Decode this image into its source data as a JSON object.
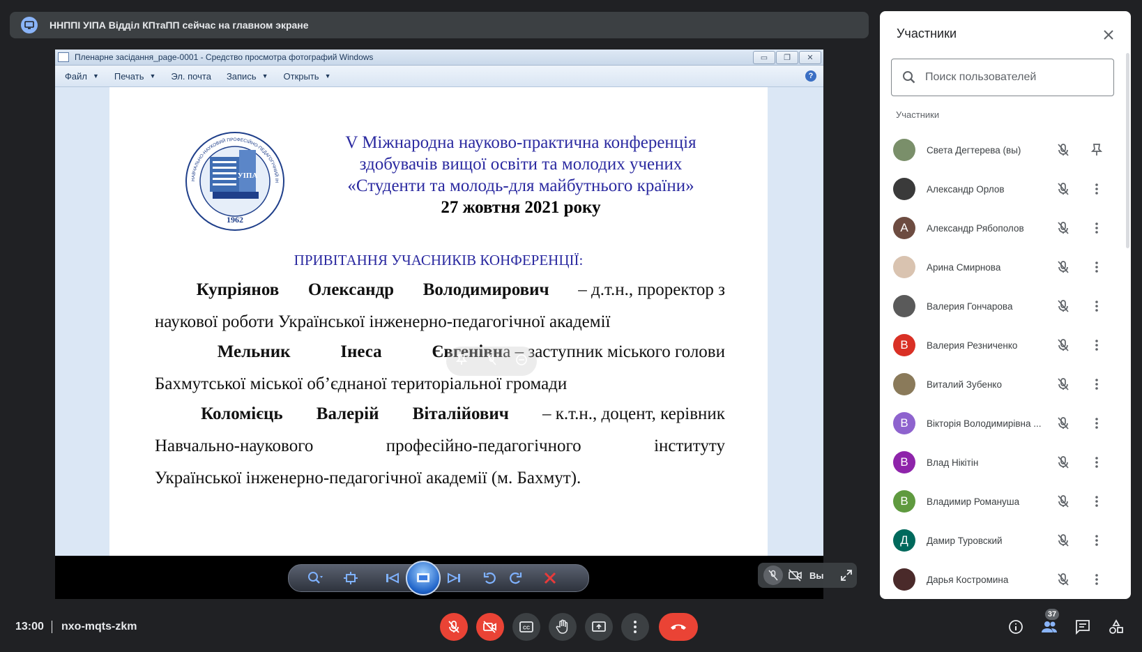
{
  "banner": {
    "text": "ННППІ УІПА Відділ КПтаПП сейчас на главном экране"
  },
  "viewer": {
    "title": "Пленарне засідання_page-0001 - Средство просмотра фотографий Windows",
    "menu": [
      "Файл",
      "Печать",
      "Эл. почта",
      "Запись",
      "Открыть"
    ],
    "help": "?"
  },
  "document": {
    "logo_year": "1962",
    "logo_text": "УІПА",
    "logo_ring": "НАВЧАЛЬНО-НАУКОВИЙ ПРОФЕСІЙНО-ПЕДАГОГІЧНИЙ ІНСТИТУТ",
    "conf_line1": "V Міжнародна науково-практична конференція",
    "conf_line2": "здобувачів вищої освіти та молодих учених",
    "conf_line3": "«Студенти та молодь-для майбутнього країни»",
    "conf_date": "27 жовтня 2021 року",
    "greeting": "ПРИВІТАННЯ УЧАСНИКІВ КОНФЕРЕНЦІЇ:",
    "p1_w1": "Купріянов",
    "p1_w2": "Олександр",
    "p1_w3": "Володимирович",
    "p1_rest": "– д.т.н., проректор з",
    "p1_line2": "наукової роботи Української інженерно-педагогічної академії",
    "p2_w1": "Мельник",
    "p2_w2": "Інеса",
    "p2_w3": "Євгенівн",
    "p2_rest": "а – заступник міського голови",
    "p2_line2": "Бахмутської міської об’єднаної територіальної громади",
    "p3_w1": "Коломієць",
    "p3_w2": "Валерій",
    "p3_w3": "Віталійович",
    "p3_rest": "– к.т.н., доцент, керівник",
    "p3_line2a": "Навчально-наукового",
    "p3_line2b": "професійно-педагогічного",
    "p3_line2c": "інституту",
    "p3_line3": "Української інженерно-педагогічної академії (м. Бахмут)."
  },
  "selfview": {
    "label": "Вы"
  },
  "panel": {
    "title": "Участники",
    "search_placeholder": "Поиск пользователей",
    "section": "Участники",
    "participants": [
      {
        "name": "Света Дегтерева (вы)",
        "initial": "",
        "color": "#7a8f6a"
      },
      {
        "name": "Александр Орлов",
        "initial": "",
        "color": "#3a3a3a"
      },
      {
        "name": "Александр Рябополов",
        "initial": "А",
        "color": "#6d4c41"
      },
      {
        "name": "Арина Смирнова",
        "initial": "",
        "color": "#d9c3b0"
      },
      {
        "name": "Валерия Гончарова",
        "initial": "",
        "color": "#5a5a5a"
      },
      {
        "name": "Валерия Резниченко",
        "initial": "В",
        "color": "#d93025"
      },
      {
        "name": "Виталий Зубенко",
        "initial": "",
        "color": "#8a7a5a"
      },
      {
        "name": "Вікторія Володимирівна ...",
        "initial": "В",
        "color": "#8e63ce"
      },
      {
        "name": "Влад Нікітін",
        "initial": "В",
        "color": "#8e24aa"
      },
      {
        "name": "Владимир Романуша",
        "initial": "В",
        "color": "#5f9a3f"
      },
      {
        "name": "Дамир Туровский",
        "initial": "Д",
        "color": "#00695c"
      },
      {
        "name": "Дарья Костромина",
        "initial": "",
        "color": "#4a2a2a"
      }
    ]
  },
  "bottom": {
    "time": "13:00",
    "meeting_code": "nxo-mqts-zkm",
    "participant_count": "37"
  }
}
